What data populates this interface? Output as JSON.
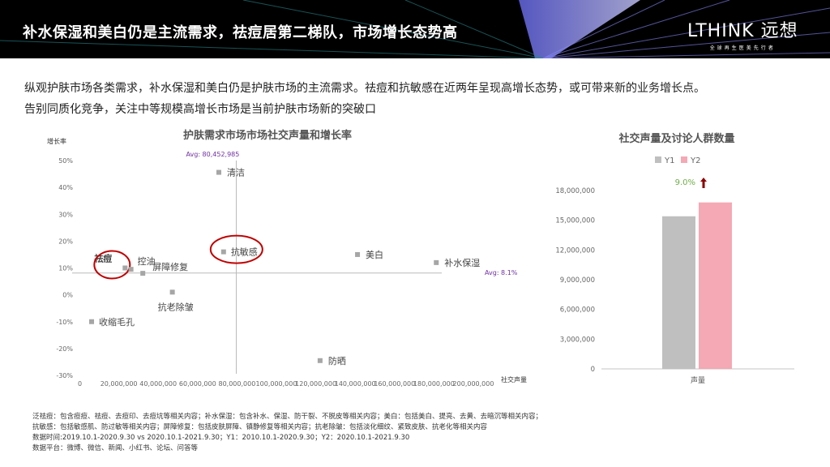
{
  "header": {
    "title": "补水保湿和美白仍是主流需求，祛痘居第二梯队，市场增长态势高",
    "logo": "LTHINK 远想",
    "logo_sub": "全球再生医美先行者"
  },
  "intro": [
    "纵观护肤市场各类需求，补水保湿和美白仍是护肤市场的主流需求。祛痘和抗敏感在近两年呈现高增长态势，或可带来新的业务增长点。",
    "告别同质化竞争，关注中等规模高增长市场是当前护肤市场新的突破口"
  ],
  "notes": [
    "泛祛痘：包含痘痘、祛痘、去痘印、去痘坑等相关内容；补水保湿：包含补水、保湿、防干裂、不脱皮等相关内容；美白：包括美白、提亮、去黄、去暗沉等相关内容；",
    "抗敏感：包括敏感肌、防过敏等相关内容；屏障修复：包括皮肤屏障、镇静修复等相关内容；抗老除皱：包括淡化细纹、紧致皮肤、抗老化等相关内容",
    "数据时间:2019.10.1-2020.9.30 vs 2020.10.1-2021.9.30；Y1：2010.10.1-2020.9.30；Y2：2020.10.1-2021.9.30",
    "数据平台：微博、微信、新闻、小红书、论坛、问答等"
  ],
  "chart_data": [
    {
      "type": "scatter",
      "title": "护肤需求市场市场社交声量和增长率",
      "xlabel": "社交声量",
      "ylabel": "增长率",
      "xlim": [
        0,
        200000000
      ],
      "ylim": [
        -30,
        50
      ],
      "xticks": [
        "0",
        "20,000,000",
        "40,000,000",
        "60,000,000",
        "80,000,000",
        "100,000,000",
        "120,000,000",
        "140,000,000",
        "160,000,000",
        "180,000,000",
        "200,000,000"
      ],
      "yticks": [
        "-30%",
        "-20%",
        "-10%",
        "0%",
        "10%",
        "20%",
        "30%",
        "40%",
        "50%"
      ],
      "avg_x": 80452985,
      "avg_x_label": "Avg: 80,452,985",
      "avg_y": 8.1,
      "avg_y_label": "Avg: 8.1%",
      "points": [
        {
          "name": "清洁",
          "x": 71600000,
          "y": 45.6
        },
        {
          "name": "抗敏感",
          "x": 74000000,
          "y": 16,
          "highlight": true
        },
        {
          "name": "美白",
          "x": 142000000,
          "y": 15
        },
        {
          "name": "补水保湿",
          "x": 182000000,
          "y": 12
        },
        {
          "name": "祛痘",
          "x": 24000000,
          "y": 10,
          "highlight": true
        },
        {
          "name": "控油",
          "x": 27000000,
          "y": 9.5
        },
        {
          "name": "屏障修复",
          "x": 33000000,
          "y": 8
        },
        {
          "name": "抗老除皱",
          "x": 48000000,
          "y": 1
        },
        {
          "name": "收缩毛孔",
          "x": 7000000,
          "y": -10
        },
        {
          "name": "防晒",
          "x": 123000000,
          "y": -24.5
        }
      ],
      "highlight_color": "#c00000",
      "avg_color": "#7030a0"
    },
    {
      "type": "bar",
      "title": "社交声量及讨论人群数量",
      "categories": [
        "声量"
      ],
      "series": [
        {
          "name": "Y1",
          "values": [
            15400000
          ],
          "color": "#bfbfbf"
        },
        {
          "name": "Y2",
          "values": [
            16800000
          ],
          "color": "#f4a9b4"
        }
      ],
      "ylim": [
        0,
        18000000
      ],
      "yticks": [
        "0",
        "3,000,000",
        "6,000,000",
        "9,000,000",
        "12,000,000",
        "15,000,000",
        "18,000,000"
      ],
      "annotation": "9.0%",
      "annotation_color": "#70ad47",
      "arrow_color": "#8b0000",
      "legend": "top"
    }
  ]
}
